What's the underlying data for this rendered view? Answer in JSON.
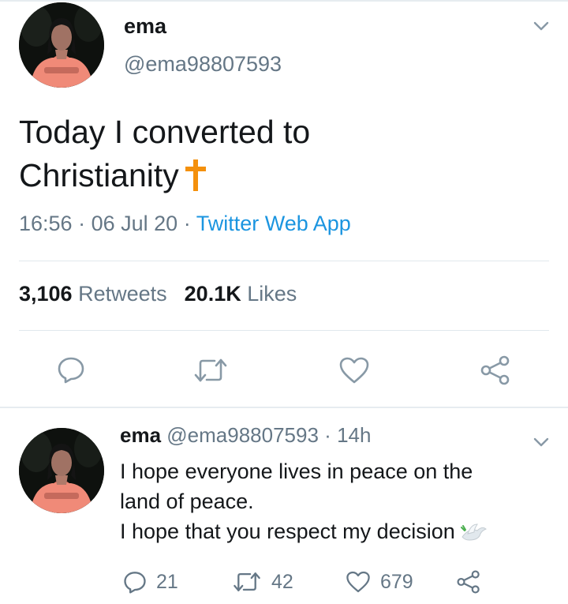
{
  "main_tweet": {
    "display_name": "ema",
    "handle": "@ema98807593",
    "text_line1": "Today I converted to",
    "text_line2": "Christianity",
    "emoji": "latin-cross",
    "time": "16:56",
    "date": "06 Jul 20",
    "source": "Twitter Web App",
    "dot": "·",
    "retweets_count": "3,106",
    "retweets_label": "Retweets",
    "likes_count": "20.1K",
    "likes_label": "Likes",
    "actions": [
      "reply-icon",
      "retweet-icon",
      "like-icon",
      "share-icon"
    ]
  },
  "reply_tweet": {
    "display_name": "ema",
    "handle": "@ema98807593",
    "dot": "·",
    "age": "14h",
    "line1": "I hope everyone lives in peace on the",
    "line2": "land of peace.",
    "line3": "I hope that you respect my decision",
    "emoji": "dove",
    "replies": "21",
    "retweets": "42",
    "likes": "679"
  },
  "colors": {
    "text": "#14171a",
    "muted": "#657786",
    "link": "#1b95e0",
    "icon": "#8899a6",
    "divider": "#e1e8ed",
    "cross": "#f4900c"
  }
}
